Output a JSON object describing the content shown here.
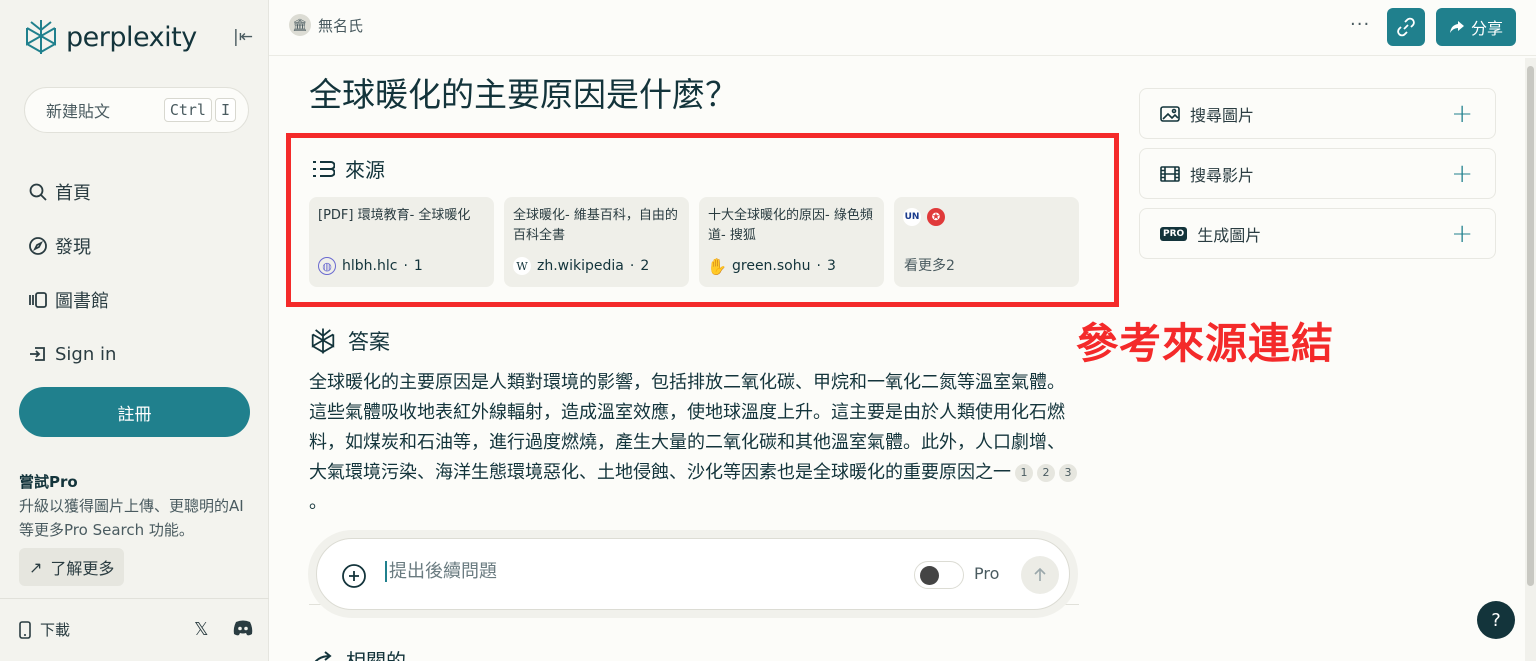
{
  "sidebar": {
    "logo_text": "perplexity",
    "new_thread": {
      "label": "新建貼文",
      "kbd_ctrl": "Ctrl",
      "kbd_key": "I"
    },
    "nav": [
      {
        "label": "首頁",
        "icon": "search-icon"
      },
      {
        "label": "發現",
        "icon": "compass-icon"
      },
      {
        "label": "圖書館",
        "icon": "library-icon"
      },
      {
        "label": "Sign in",
        "icon": "sign-in-icon"
      }
    ],
    "signup_label": "註冊",
    "pro": {
      "title": "嘗試Pro",
      "description": "升級以獲得圖片上傳、更聰明的AI等更多Pro Search 功能。",
      "learn_more": "了解更多"
    },
    "footer": {
      "download": "下載"
    }
  },
  "topbar": {
    "user_name": "無名氏",
    "more": "···",
    "share_label": "分享"
  },
  "main": {
    "title": "全球暖化的主要原因是什麼？",
    "sources_label": "來源",
    "sources": [
      {
        "title": "[PDF] 環境教育- 全球暖化",
        "site": "hlbh.hlc",
        "index": "1",
        "favicon": "globe-icon"
      },
      {
        "title": "全球暖化- 維基百科，自由的百科全書",
        "site": "zh.wikipedia",
        "index": "2",
        "favicon": "wikipedia-icon"
      },
      {
        "title": "十大全球暖化的原因- 綠色頻道- 搜狐",
        "site": "green.sohu",
        "index": "3",
        "favicon": "sohu-icon"
      }
    ],
    "more_sources": {
      "label": "看更多",
      "count": "2"
    },
    "annotation": "參考來源連結",
    "answer_label": "答案",
    "answer_text": "全球暖化的主要原因是人類對環境的影響，包括排放二氧化碳、甲烷和一氧化二氮等溫室氣體。這些氣體吸收地表紅外線輻射，造成溫室效應，使地球溫度上升。這主要是由於人類使用化石燃料，如煤炭和石油等，進行過度燃燒，產生大量的二氧化碳和其他溫室氣體。此外，人口劇增、大氣環境污染、海洋生態環境惡化、土地侵蝕、沙化等因素也是全球暖化的重要原因之一",
    "citations": [
      "1",
      "2",
      "3"
    ],
    "answer_end": "。",
    "followup": {
      "placeholder": "提出後續問題",
      "pro_label": "Pro"
    },
    "related_label": "相關的"
  },
  "right_panel": [
    {
      "label": "搜尋圖片",
      "icon": "image-icon"
    },
    {
      "label": "搜尋影片",
      "icon": "film-icon"
    },
    {
      "label": "生成圖片",
      "icon": "pro-badge-icon",
      "badge": "PRO"
    }
  ],
  "help_label": "?",
  "colors": {
    "accent": "#20808d",
    "annotation": "#f42a2a",
    "text": "#13343b"
  }
}
